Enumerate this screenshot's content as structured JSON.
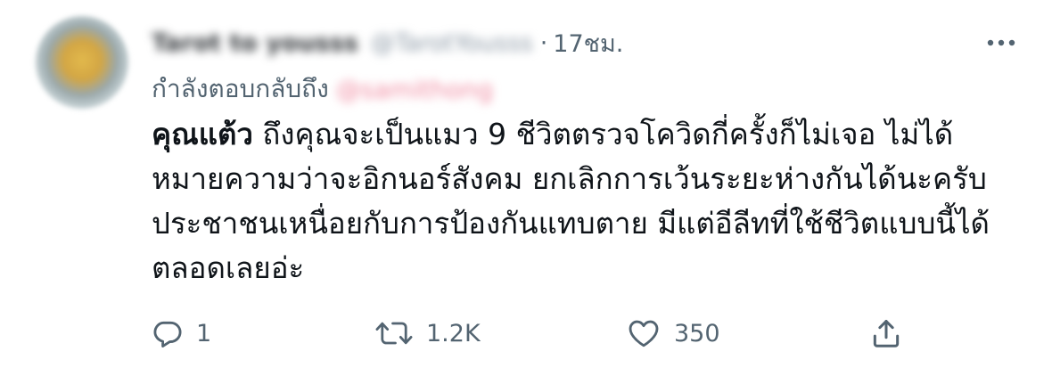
{
  "tweet": {
    "author": {
      "display_name": "Tarot to yousss",
      "handle": "@TarotYousss"
    },
    "separator": "·",
    "time": "17ชม.",
    "more_icon": "more-dots-icon",
    "reply_to": {
      "label": "กำลังตอบกลับถึง",
      "mention": "@samithong"
    },
    "body": {
      "bold_prefix": "คุณแต้ว",
      "line1_rest": " ถึงคุณจะเป็นแมว 9 ชีวิตตรวจโควิดกี่ครั้งก็ไม่เจอ ไม่ได้",
      "line2": "หมายความว่าจะอิกนอร์สังคม ยกเลิกการเว้นระยะห่างกันได้นะครับ",
      "line3": "ประชาชนเหนื่อยกับการป้องกันแทบตาย มีแต่อีลีทที่ใช้ชีวิตแบบนี้ได้",
      "line4": "ตลอดเลยอ่ะ"
    },
    "actions": {
      "reply": {
        "icon": "reply-bubble-icon",
        "count": "1"
      },
      "retweet": {
        "icon": "retweet-icon",
        "count": "1.2K"
      },
      "like": {
        "icon": "heart-icon",
        "count": "350"
      },
      "share": {
        "icon": "share-icon"
      }
    },
    "colors": {
      "text": "#0f1419",
      "secondary": "#536471",
      "mention": "#f08aa0"
    }
  }
}
